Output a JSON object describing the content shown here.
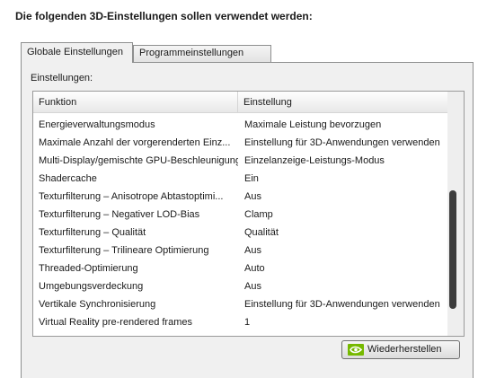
{
  "heading": "Die folgenden 3D-Einstellungen sollen verwendet werden:",
  "tabs": [
    {
      "label": "Globale Einstellungen",
      "active": true
    },
    {
      "label": "Programmeinstellungen",
      "active": false
    }
  ],
  "settings_label": "Einstellungen:",
  "table": {
    "columns": [
      "Funktion",
      "Einstellung"
    ],
    "rows": [
      {
        "feature": "Energieverwaltungsmodus",
        "value": "Maximale Leistung bevorzugen"
      },
      {
        "feature": "Maximale Anzahl der vorgerenderten Einz...",
        "value": "Einstellung für 3D-Anwendungen verwenden"
      },
      {
        "feature": "Multi-Display/gemischte GPU-Beschleunigung",
        "value": "Einzelanzeige-Leistungs-Modus"
      },
      {
        "feature": "Shadercache",
        "value": "Ein"
      },
      {
        "feature": "Texturfilterung – Anisotrope Abtastoptimi...",
        "value": "Aus"
      },
      {
        "feature": "Texturfilterung – Negativer LOD-Bias",
        "value": "Clamp"
      },
      {
        "feature": "Texturfilterung – Qualität",
        "value": "Qualität"
      },
      {
        "feature": "Texturfilterung – Trilineare Optimierung",
        "value": "Aus"
      },
      {
        "feature": "Threaded-Optimierung",
        "value": "Auto"
      },
      {
        "feature": "Umgebungsverdeckung",
        "value": "Aus"
      },
      {
        "feature": "Vertikale Synchronisierung",
        "value": "Einstellung für 3D-Anwendungen verwenden"
      },
      {
        "feature": "Virtual Reality pre-rendered frames",
        "value": "1"
      }
    ]
  },
  "restore_button": {
    "label": "Wiederherstellen",
    "icon": "nvidia-logo-icon"
  },
  "colors": {
    "panel_bg": "#f0f0f0",
    "logo_green": "#76b900"
  }
}
